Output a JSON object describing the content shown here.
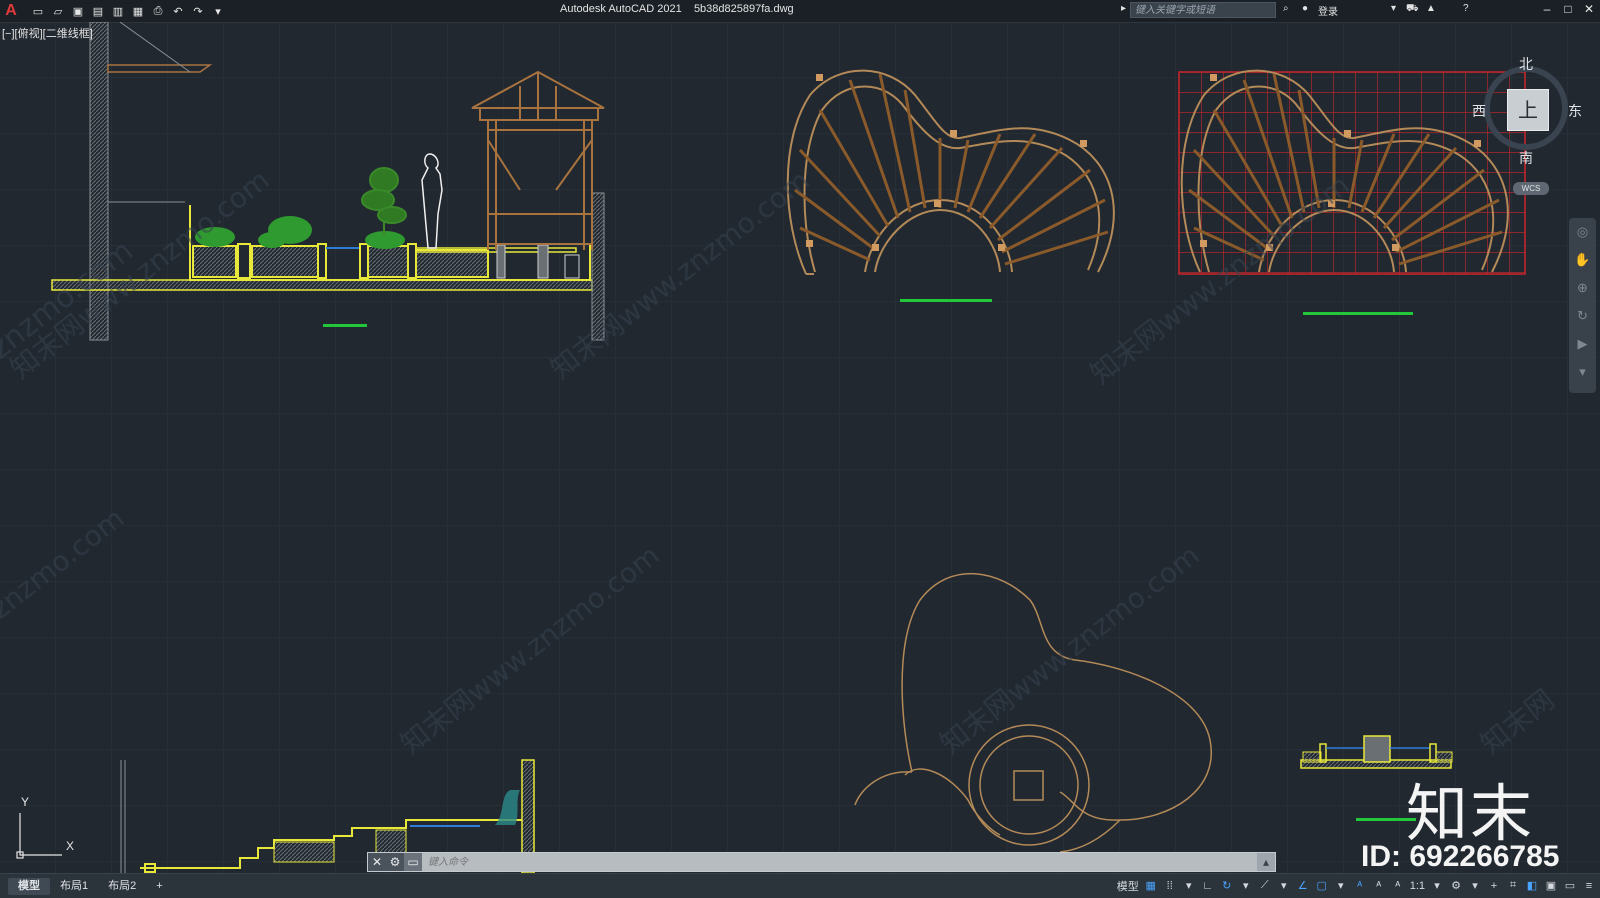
{
  "app": {
    "title": "Autodesk AutoCAD 2021",
    "filename": "5b38d825897fa.dwg",
    "logo": "A"
  },
  "search": {
    "placeholder": "键入关键字或短语"
  },
  "account": {
    "login_label": "登录"
  },
  "viewport": {
    "label": "[−][俯视][二维线框]"
  },
  "viewcube": {
    "north": "北",
    "south": "南",
    "east": "东",
    "west": "西",
    "face": "上",
    "wcs": "WCS"
  },
  "ucs": {
    "x_label": "X",
    "y_label": "Y"
  },
  "command": {
    "placeholder": "键入命令"
  },
  "layout_tabs": [
    {
      "label": "模型"
    },
    {
      "label": "布局1"
    },
    {
      "label": "布局2"
    }
  ],
  "add_tab_label": "+",
  "status": {
    "model_label": "模型",
    "scale_label": "1:1"
  },
  "watermark": {
    "logo_text": "知末",
    "id_text": "ID: 692266785",
    "url_text": "知末网www.znzmo.com"
  },
  "colors": {
    "background": "#212830",
    "grid": "#2c3540",
    "yellow": "#e8e83a",
    "brown": "#a8733e",
    "red": "#c8262b",
    "green": "#22c83a",
    "tan": "#b48a58"
  },
  "icons": [
    "new-icon",
    "open-icon",
    "save-icon",
    "save-as-icon",
    "plot-icon",
    "publish-icon",
    "print-icon",
    "undo-icon",
    "redo-icon",
    "customize-icon",
    "search-icon",
    "user-icon",
    "cart-icon",
    "a360-icon",
    "help-icon",
    "minimize-icon",
    "maximize-icon",
    "close-icon"
  ]
}
